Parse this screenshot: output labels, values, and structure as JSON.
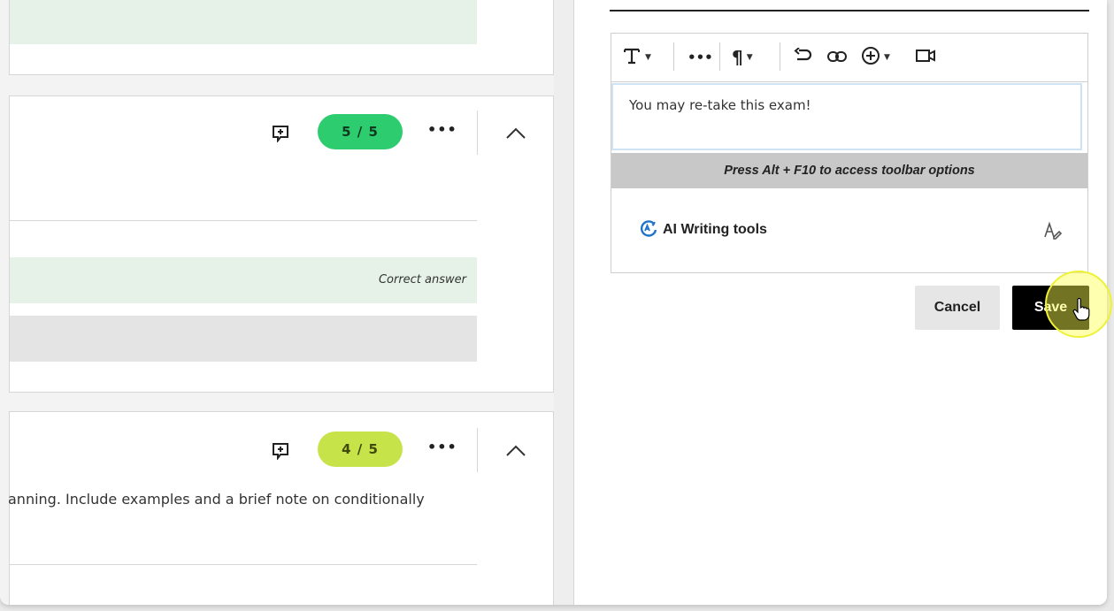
{
  "questions": [
    {
      "score": "5 / 5",
      "score_color": "#2dcc6f",
      "score_text_color": "#0f3a20",
      "correct_label": "Correct answer"
    },
    {
      "score": "4 / 5",
      "score_color": "#c7e34a",
      "score_text_color": "#3d4a08",
      "snippet": "anning. Include examples and a brief note on conditionally"
    }
  ],
  "editor": {
    "toolbar": {
      "text_style_icon": "text-style-icon",
      "more_icon": "more-dots-icon",
      "paragraph_icon": "paragraph-icon",
      "undo_icon": "undo-icon",
      "link_icon": "link-icon",
      "insert_icon": "add-content-icon",
      "video_icon": "video-icon"
    },
    "content": "You may re-take this exam!",
    "hint": "Press Alt + F10 to access toolbar options",
    "ai_tools_label": "AI Writing tools"
  },
  "buttons": {
    "cancel": "Cancel",
    "save": "Save"
  },
  "colors": {
    "accent_blue": "#1f74c9",
    "save_bg": "#000000",
    "highlight": "#eef235"
  }
}
